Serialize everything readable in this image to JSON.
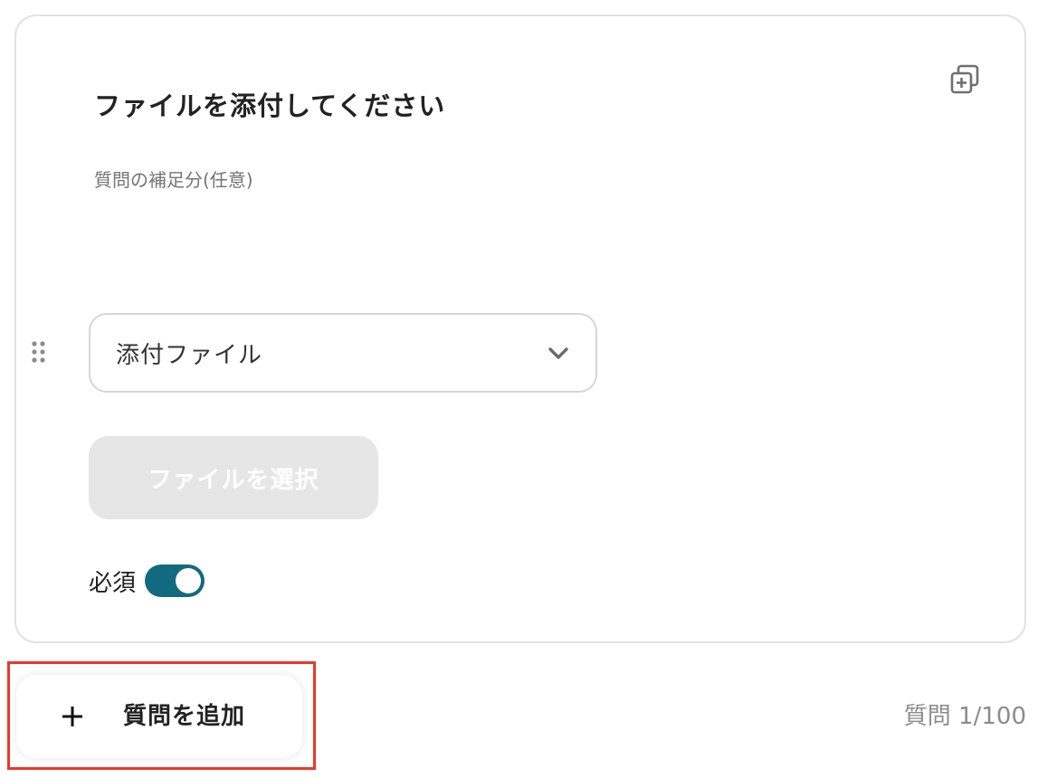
{
  "question": {
    "title": "ファイルを添付してください",
    "description_placeholder": "質問の補足分(任意)",
    "type_select": {
      "selected": "添付ファイル"
    },
    "file_button_label": "ファイルを選択",
    "required": {
      "label": "必須",
      "enabled": true
    }
  },
  "footer": {
    "add_question_label": "質問を追加",
    "counter": "質問 1/100"
  },
  "colors": {
    "toggle_on": "#126a80",
    "highlight_border": "#e8392b",
    "disabled_button": "#e6e6e6"
  },
  "icons": {
    "duplicate": "duplicate-add-icon",
    "drag": "drag-handle-icon",
    "chevron": "chevron-down-icon",
    "plus": "plus-icon"
  }
}
